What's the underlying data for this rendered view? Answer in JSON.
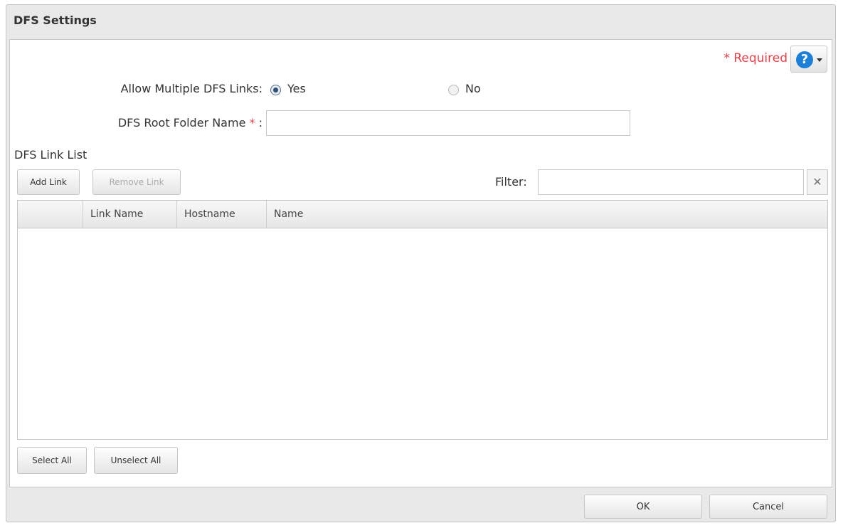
{
  "dialog": {
    "title": "DFS Settings"
  },
  "form": {
    "required_note": "* Required",
    "allow_multiple_label": "Allow Multiple DFS Links:",
    "options": [
      {
        "label": "Yes",
        "selected": true
      },
      {
        "label": "No",
        "selected": false
      }
    ],
    "root_folder_label": "DFS Root Folder Name",
    "root_folder_star": "*",
    "root_folder_colon": " :",
    "root_folder_value": ""
  },
  "help": {
    "icon": "question-icon",
    "glyph": "?",
    "color": "#1c7fd8"
  },
  "link_list": {
    "section_title": "DFS Link List",
    "add_button": "Add Link",
    "remove_button": "Remove Link",
    "remove_disabled": true,
    "filter_label": "Filter:",
    "filter_value": "",
    "filter_clear": "✕",
    "columns": [
      "",
      "Link Name",
      "Hostname",
      "Name"
    ],
    "rows": [],
    "select_all": "Select All",
    "unselect_all": "Unselect All"
  },
  "footer": {
    "ok": "OK",
    "cancel": "Cancel"
  },
  "colors": {
    "required": "#e0414a",
    "dialog_bg": "#e9e9e9"
  }
}
